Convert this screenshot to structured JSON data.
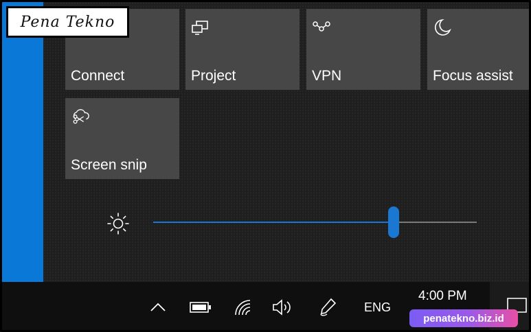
{
  "branding": {
    "logo_text": "Pena Tekno",
    "watermark": "penatekno.biz.id"
  },
  "quick_actions": {
    "tiles": [
      {
        "label": "Connect",
        "icon": "connect-icon"
      },
      {
        "label": "Project",
        "icon": "project-icon"
      },
      {
        "label": "VPN",
        "icon": "vpn-icon"
      },
      {
        "label": "Focus assist",
        "icon": "moon-icon"
      },
      {
        "label": "Screen snip",
        "icon": "screen-snip-icon"
      }
    ]
  },
  "brightness": {
    "icon": "sun-icon",
    "level_percent": 74
  },
  "taskbar": {
    "tray_icons": [
      "chevron-up-icon",
      "battery-icon",
      "wifi-icon",
      "volume-icon",
      "pen-icon"
    ],
    "language": "ENG",
    "time": "4:00 PM",
    "notification_icon": "notification-icon"
  },
  "colors": {
    "accent": "#1a77d2",
    "tile_bg": "#474747",
    "desktop_blue": "#0a78d7"
  }
}
